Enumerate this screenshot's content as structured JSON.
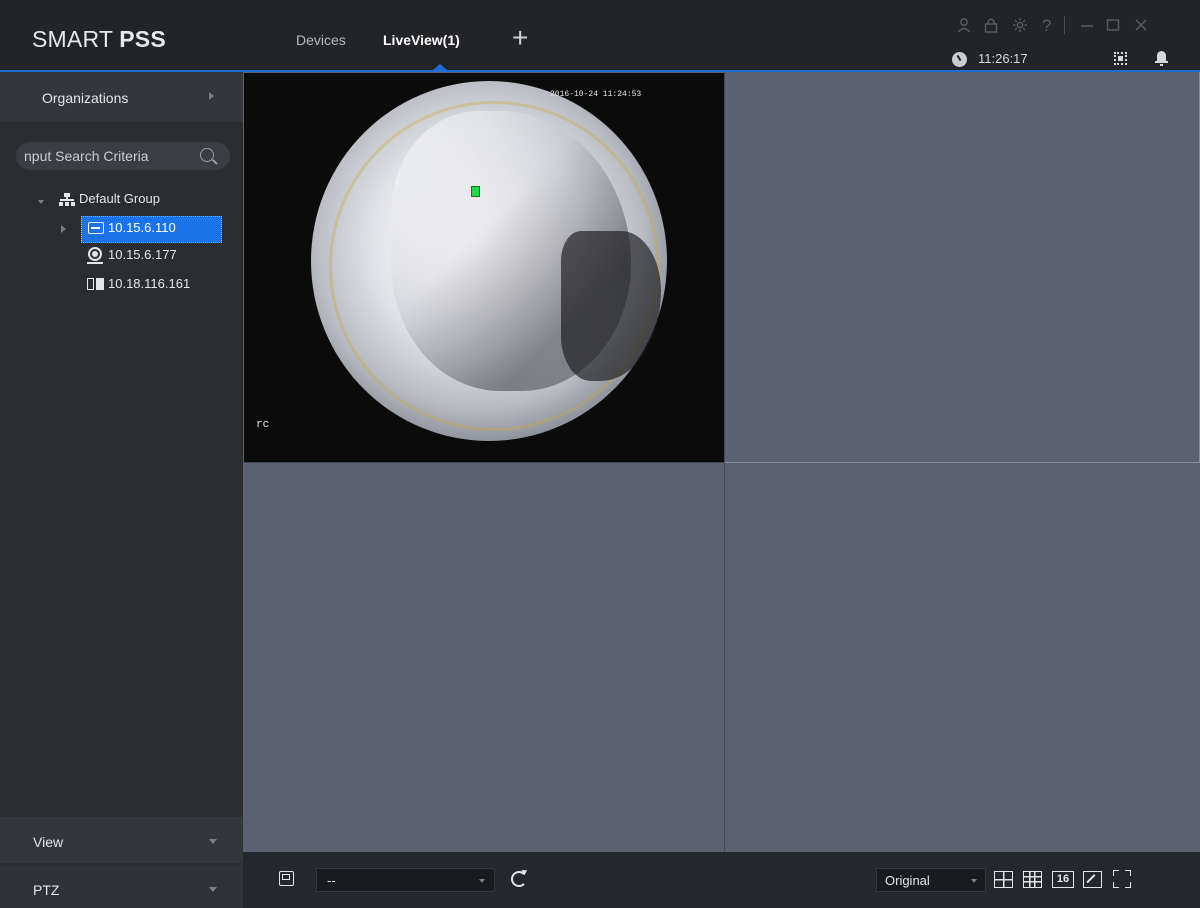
{
  "app": {
    "logo_light": "SMART ",
    "logo_bold": "PSS"
  },
  "tabs": [
    {
      "label": "Devices",
      "active": false
    },
    {
      "label": "LiveView(1)",
      "active": true
    }
  ],
  "add_tab_glyph": "+",
  "window_icons": [
    "user-icon",
    "lock-icon",
    "settings-icon",
    "help-icon",
    "minimize-icon",
    "maximize-icon",
    "close-icon"
  ],
  "status": {
    "time": "11:26:17"
  },
  "sidebar": {
    "organizations_label": "Organizations",
    "search_placeholder": "nput Search Criteria",
    "group_label": "Default Group",
    "devices": [
      {
        "label": "10.15.6.110",
        "icon": "nvr-icon",
        "selected": true
      },
      {
        "label": "10.15.6.177",
        "icon": "camera-icon",
        "selected": false
      },
      {
        "label": "10.18.116.161",
        "icon": "door-station-icon",
        "selected": false
      }
    ],
    "view_label": "View",
    "ptz_label": "PTZ"
  },
  "video": {
    "timestamp": "2016-10-24 11:24:53",
    "channel_label": "rc"
  },
  "toolbar": {
    "select_value": "--",
    "stream_value": "Original",
    "layout_16_label": "16"
  },
  "colors": {
    "accent": "#1d6bd6",
    "selected_device": "#1a73e8",
    "grid_cell": "#5b6170"
  }
}
